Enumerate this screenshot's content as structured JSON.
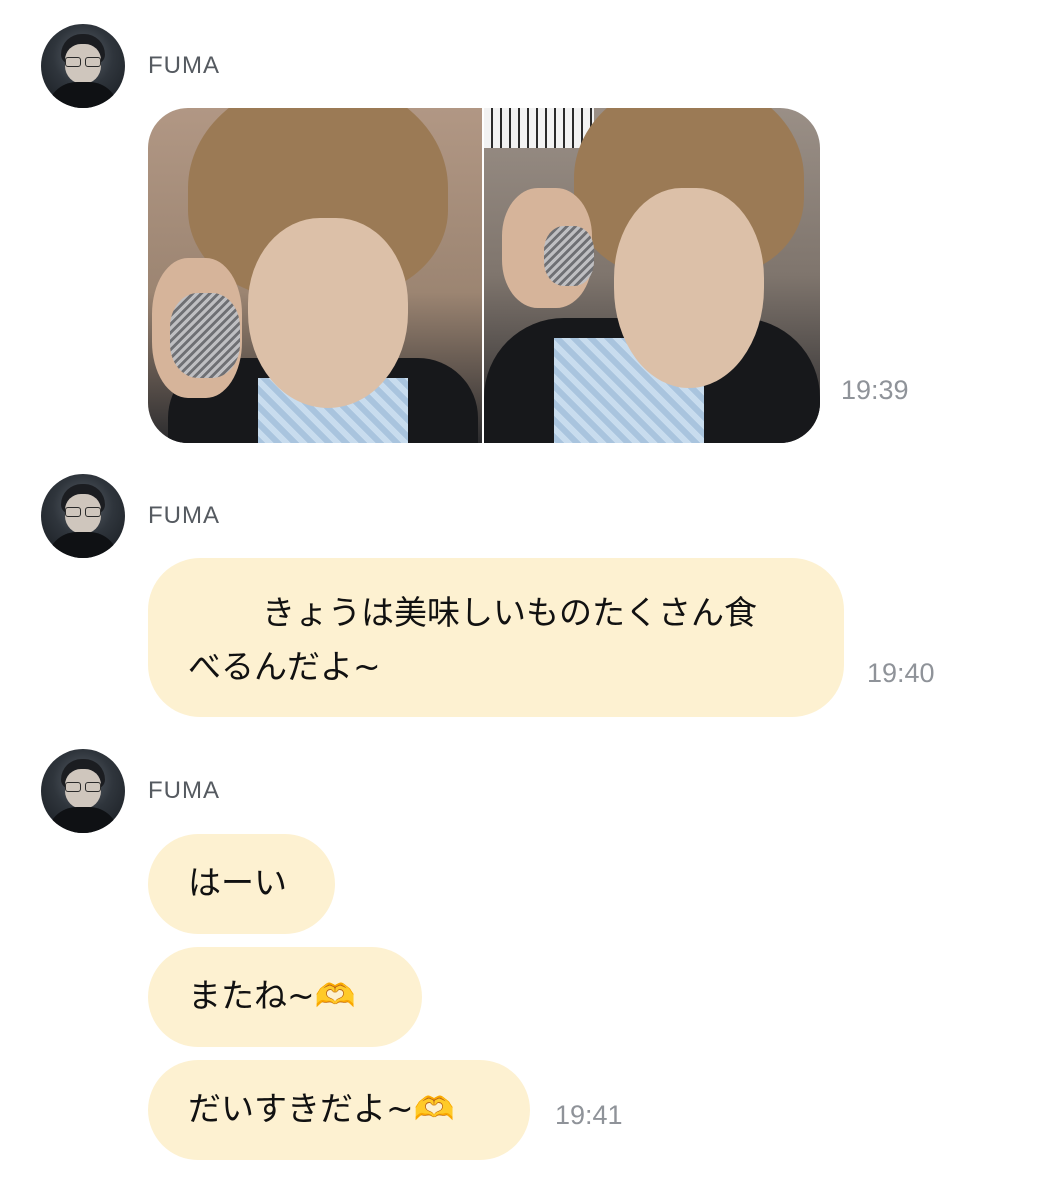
{
  "messages": [
    {
      "sender": "FUMA",
      "type": "images",
      "time": "19:39"
    },
    {
      "sender": "FUMA",
      "type": "text",
      "line1": "きょうは美味しいものたくさん食",
      "line2": "べるんだよ~",
      "time": "19:40"
    },
    {
      "sender": "FUMA",
      "type": "text-group",
      "texts": [
        "はーい",
        "またね~",
        "だいすきだよ~"
      ],
      "emoji": "🫶",
      "time": "19:41"
    }
  ],
  "colors": {
    "bubble": "#fdf1d1",
    "time": "#8f9399",
    "sender": "#555a60"
  }
}
